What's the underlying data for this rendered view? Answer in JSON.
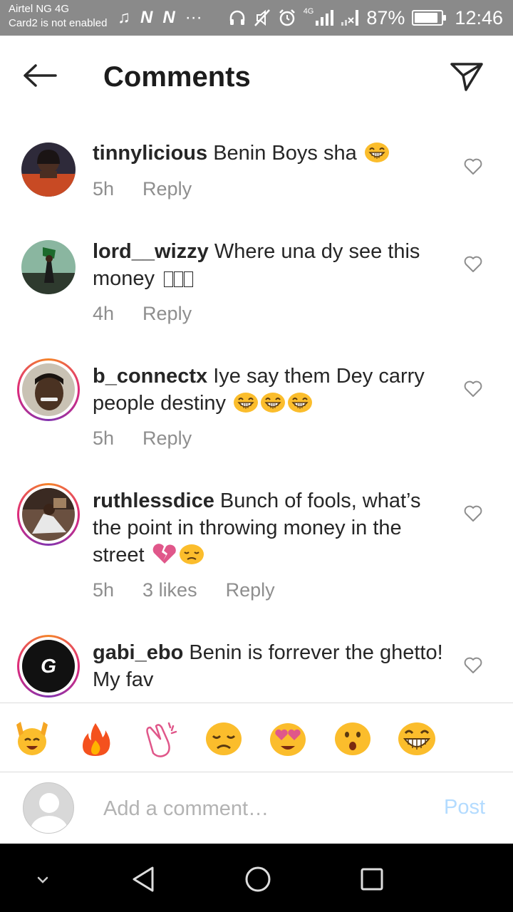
{
  "status_bar": {
    "carrier": "Airtel NG 4G",
    "sim_note": "Card2 is not enabled",
    "notif_n1": "N",
    "notif_n2": "N",
    "more": "···",
    "network_label": "4G",
    "battery_percent_text": "87%",
    "battery_level": 0.87,
    "time": "12:46"
  },
  "header": {
    "title": "Comments",
    "back_icon": "arrow-left-icon",
    "send_icon": "paper-plane-icon"
  },
  "comments": [
    {
      "username": "tinnylicious",
      "text": "Benin Boys sha",
      "emojis": [
        "joy"
      ],
      "time": "5h",
      "likes": "",
      "reply": "Reply",
      "story_ring": false,
      "avatar_color": "#c45a2a"
    },
    {
      "username": "lord__wizzy",
      "text": "Where una dy see this money",
      "emojis": [
        "missing",
        "missing",
        "missing"
      ],
      "time": "4h",
      "likes": "",
      "reply": "Reply",
      "story_ring": false,
      "avatar_color": "#4a6a50"
    },
    {
      "username": "b_connectx",
      "text": "Iye say them Dey carry people destiny",
      "emojis": [
        "joy",
        "joy",
        "joy"
      ],
      "time": "5h",
      "likes": "",
      "reply": "Reply",
      "story_ring": true,
      "avatar_color": "#6a5a40"
    },
    {
      "username": "ruthlessdice",
      "text": "Bunch of fools, what’s the point in throwing money in the street",
      "emojis": [
        "broken-heart",
        "disappointed"
      ],
      "time": "5h",
      "likes": "3 likes",
      "reply": "Reply",
      "story_ring": true,
      "avatar_color": "#8a6a50"
    },
    {
      "username": "gabi_ebo",
      "text": "Benin is forrever the ghetto! My fav",
      "emojis": [],
      "time": "",
      "likes": "",
      "reply": "",
      "story_ring": true,
      "avatar_letter": "G",
      "avatar_color": "#111111"
    }
  ],
  "quick_reactions": [
    "raised-hands",
    "fire",
    "clapping-hands",
    "disappointed",
    "heart-eyes",
    "hushed",
    "joy"
  ],
  "composer": {
    "placeholder": "Add a comment…",
    "post_label": "Post"
  },
  "nav_bar": {
    "icons": [
      "collapse-chevron-icon",
      "back-triangle-icon",
      "home-circle-icon",
      "recents-square-icon"
    ]
  },
  "colors": {
    "status_bar": "#8a8a8a",
    "text": "#262626",
    "meta": "#8e8e8e",
    "post_disabled": "#b3dbff",
    "emoji_yellow": "#fbbd2c"
  }
}
